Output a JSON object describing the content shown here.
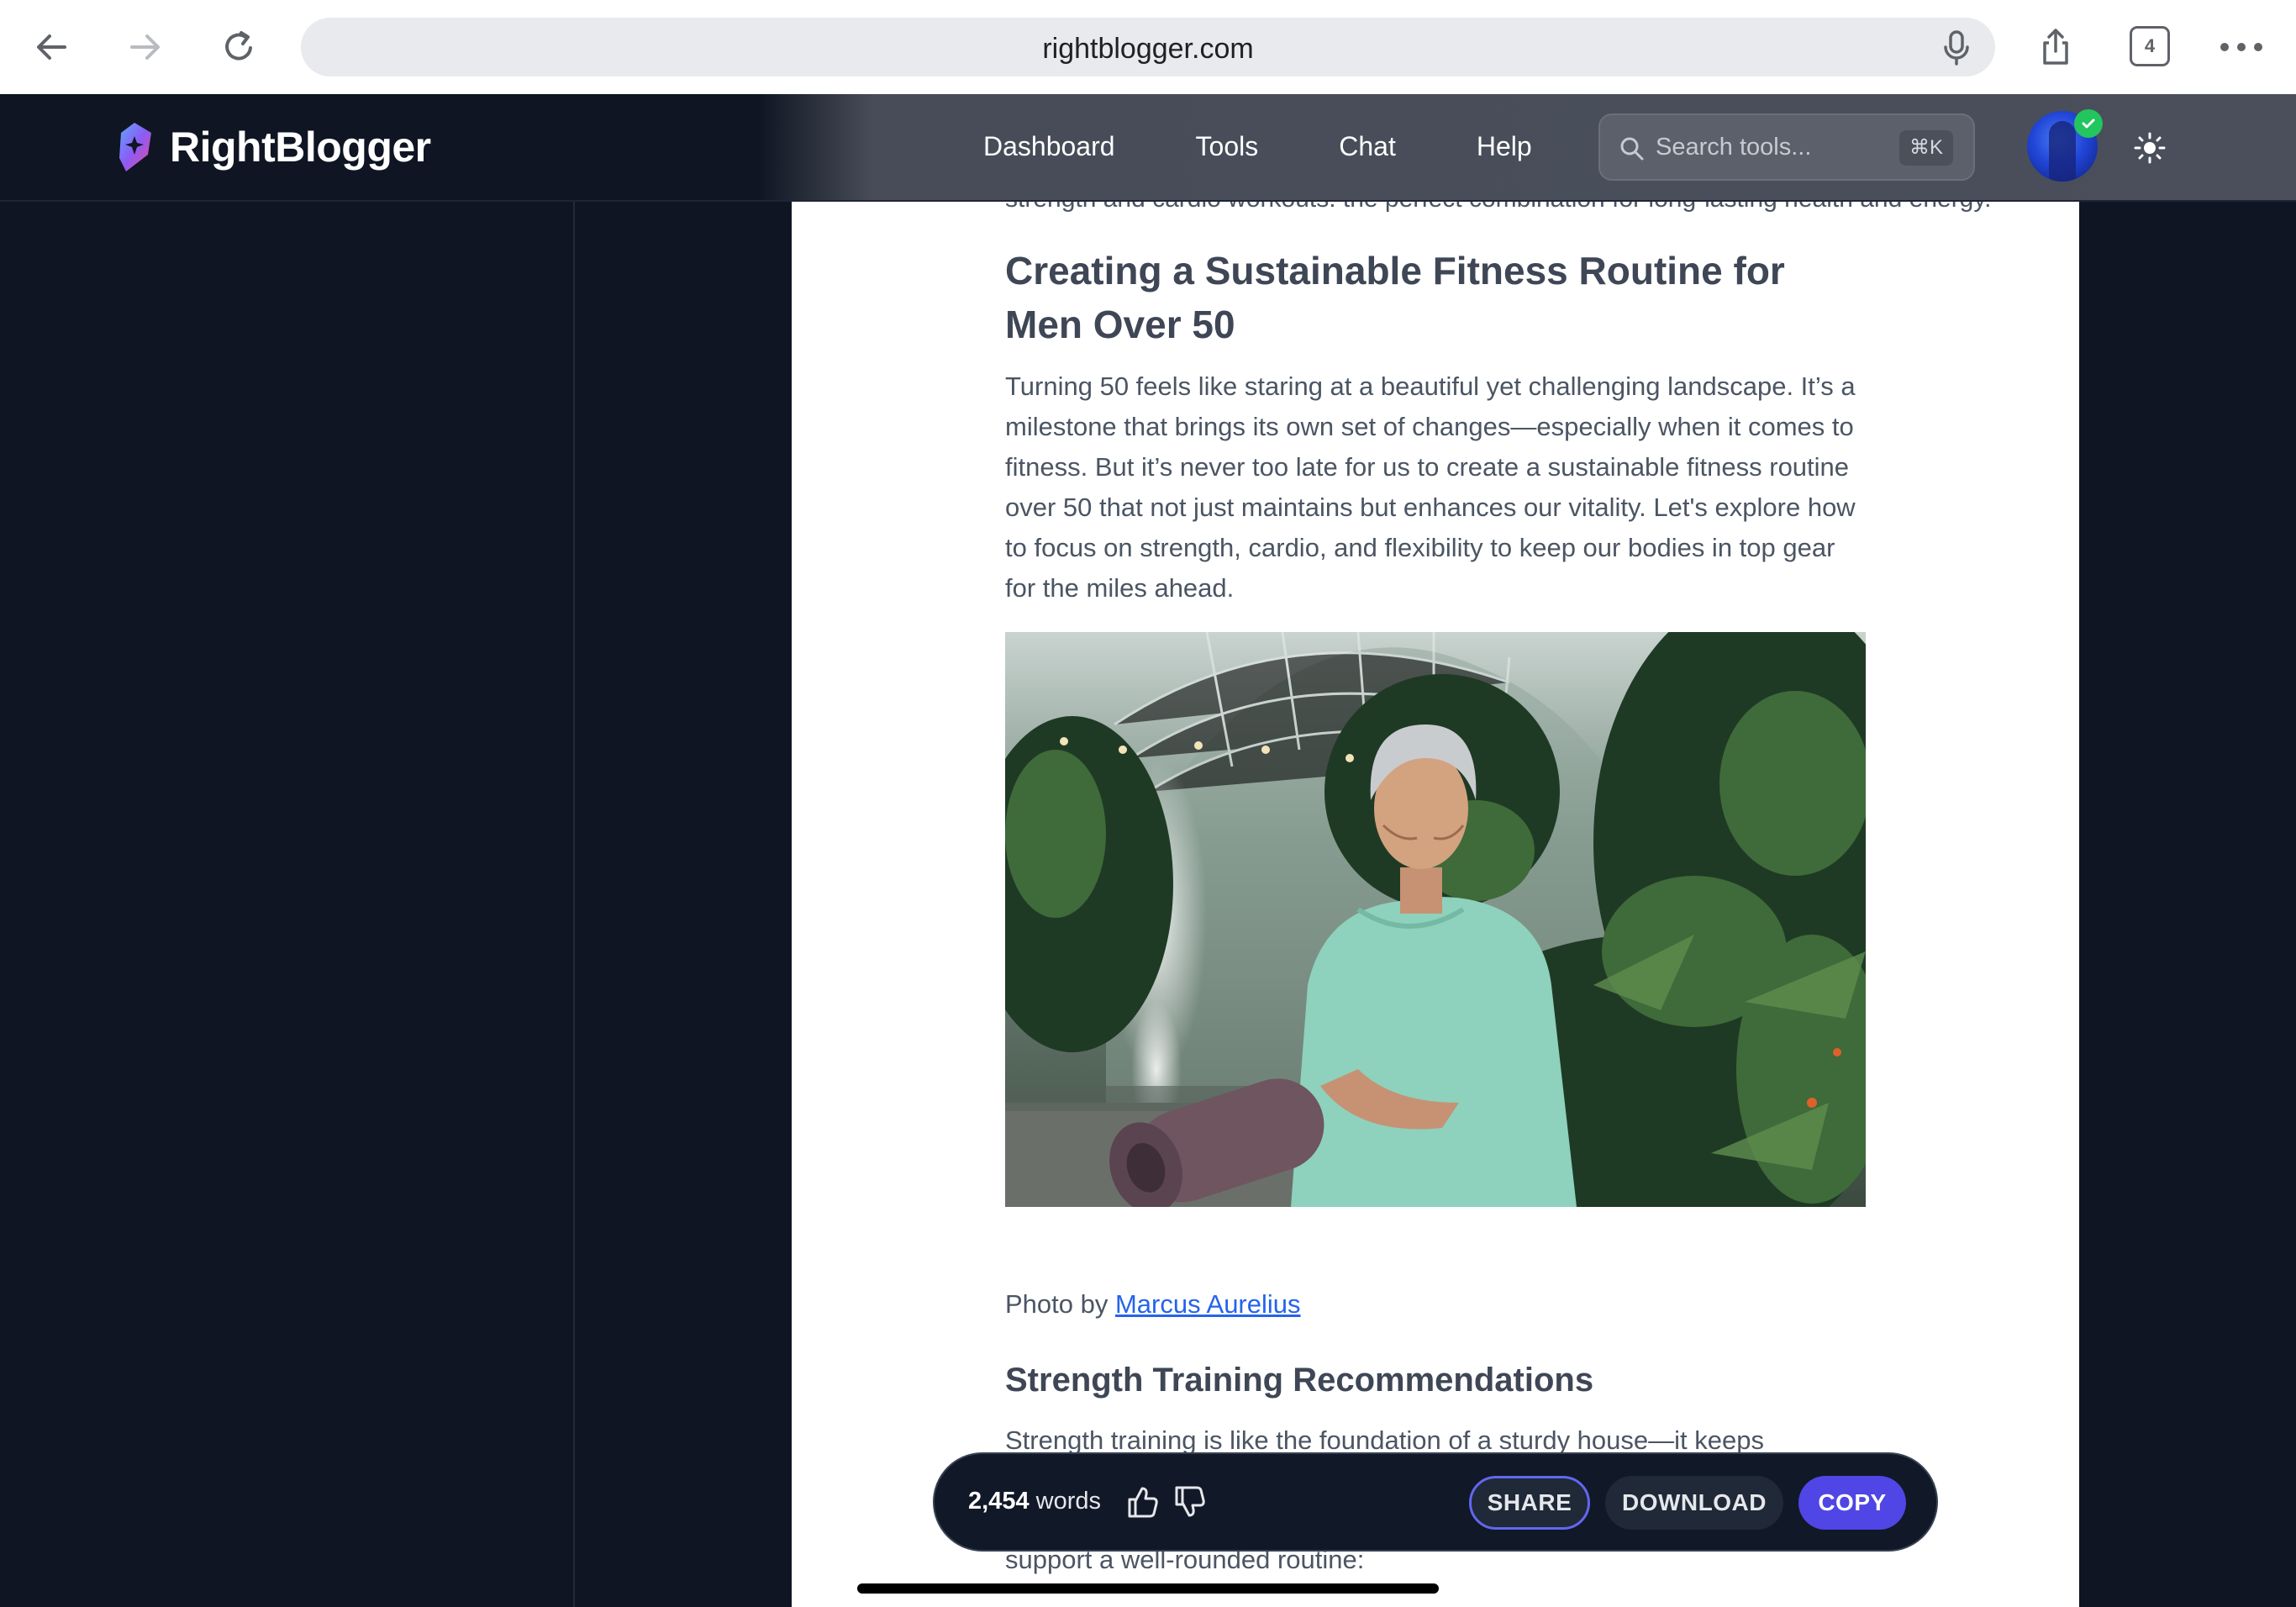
{
  "browser": {
    "url": "rightblogger.com",
    "tab_count": "4"
  },
  "header": {
    "brand": "RightBlogger",
    "nav": [
      "Dashboard",
      "Tools",
      "Chat",
      "Help"
    ],
    "search_placeholder": "Search tools...",
    "search_shortcut": "⌘K"
  },
  "article": {
    "cut_line": "strength and cardio workouts: the perfect combination for long-lasting health and energy.",
    "heading": "Creating a Sustainable Fitness Routine for Men Over 50",
    "intro": "Turning 50 feels like staring at a beautiful yet challenging landscape. It’s a milestone that brings its own set of changes—especially when it comes to fitness. But it’s never too late for us to create a sustainable fitness routine over 50 that not just maintains but enhances our vitality. Let's explore how to focus on strength, cardio, and flexibility to keep our bodies in top gear for the miles ahead.",
    "photo_credit_prefix": "Photo by ",
    "photo_credit_name": "Marcus Aurelius",
    "subheading": "Strength Training Recommendations",
    "strength_text": "Strength training is like the foundation of a sturdy house—it keeps",
    "last_line": "support a well-rounded routine:"
  },
  "action_bar": {
    "word_count": "2,454",
    "word_label": "words",
    "share": "SHARE",
    "download": "DOWNLOAD",
    "copy": "COPY"
  },
  "colors": {
    "accent": "#4f46e5",
    "dark_bg": "#0f1522",
    "link": "#2563eb",
    "verified": "#22c55e"
  }
}
